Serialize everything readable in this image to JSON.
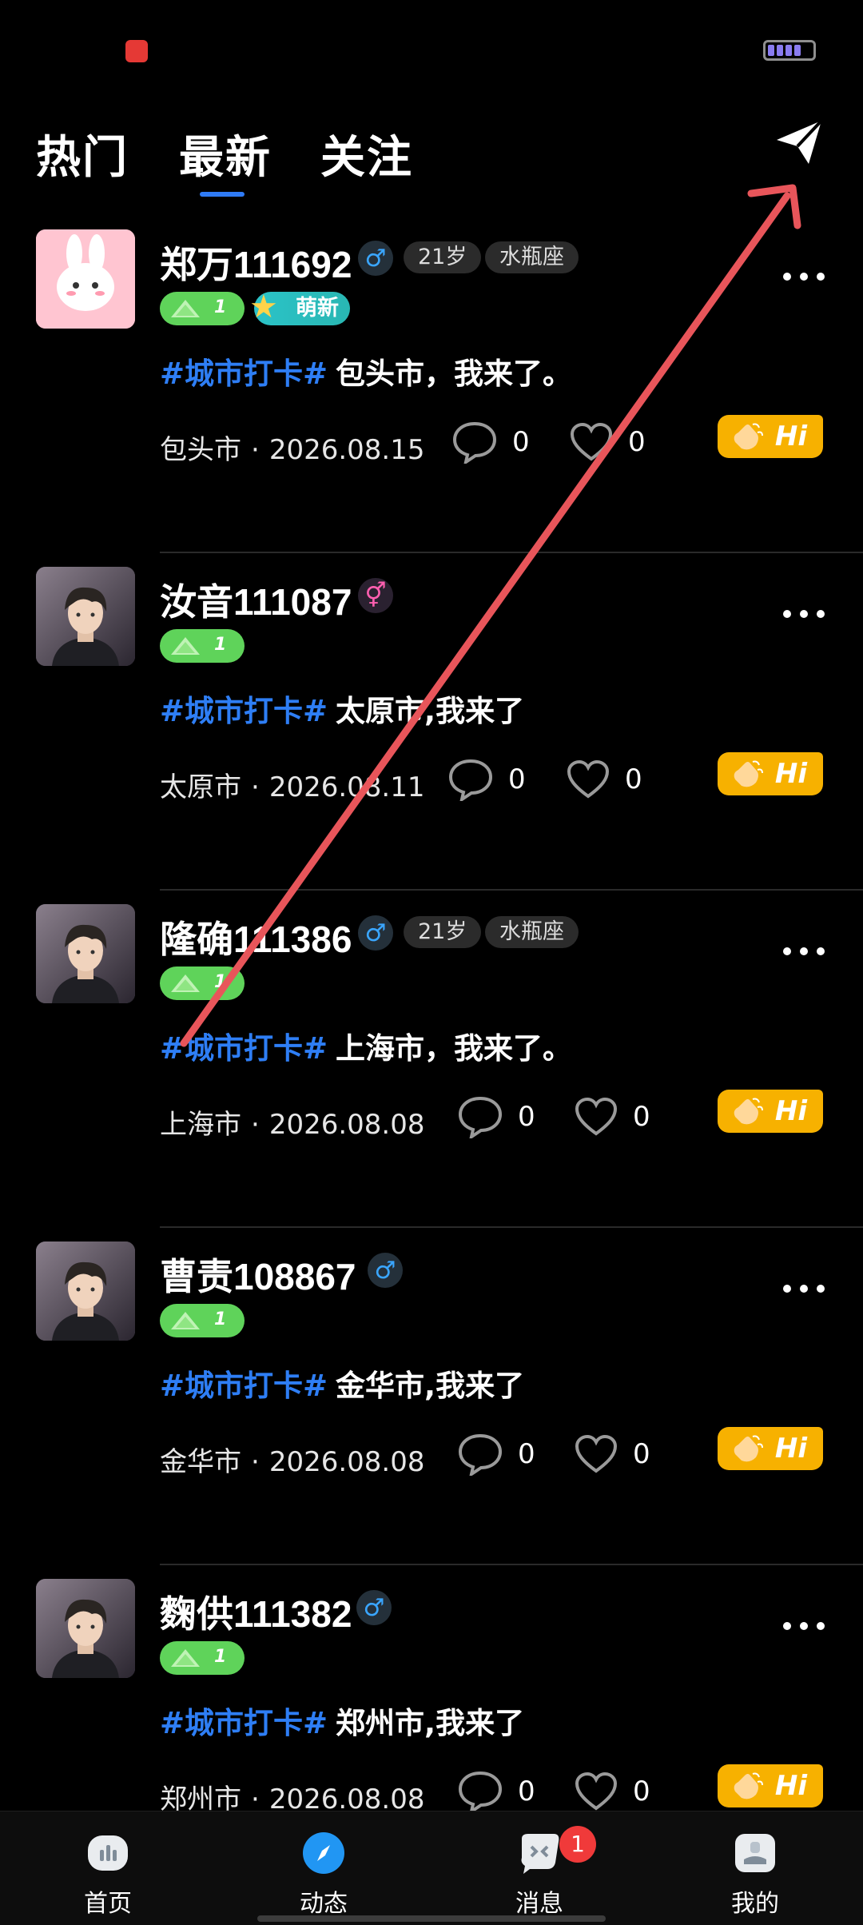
{
  "tabs": [
    {
      "label": "热门"
    },
    {
      "label": "最新"
    },
    {
      "label": "关注"
    }
  ],
  "active_tab": "最新",
  "posts": [
    {
      "name": "郑万111692",
      "gender": "male",
      "age": "21岁",
      "zodiac": "水瓶座",
      "level": "1",
      "newbie": "萌新",
      "hashtag": "#城市打卡#",
      "text": "包头市，我来了。",
      "city": "包头市",
      "date": "2026.08.15",
      "comments": "0",
      "likes": "0",
      "hi": "Hi"
    },
    {
      "name": "汝音111087",
      "gender": "female",
      "level": "1",
      "hashtag": "#城市打卡#",
      "text": "太原市,我来了",
      "city": "太原市",
      "date": "2026.08.11",
      "comments": "0",
      "likes": "0",
      "hi": "Hi"
    },
    {
      "name": "隆确111386",
      "gender": "male",
      "age": "21岁",
      "zodiac": "水瓶座",
      "level": "1",
      "hashtag": "#城市打卡#",
      "text": "上海市，我来了。",
      "city": "上海市",
      "date": "2026.08.08",
      "comments": "0",
      "likes": "0",
      "hi": "Hi"
    },
    {
      "name": "曹责108867",
      "gender": "male",
      "level": "1",
      "hashtag": "#城市打卡#",
      "text": "金华市,我来了",
      "city": "金华市",
      "date": "2026.08.08",
      "comments": "0",
      "likes": "0",
      "hi": "Hi"
    },
    {
      "name": "麴供111382",
      "gender": "male",
      "level": "1",
      "hashtag": "#城市打卡#",
      "text": "郑州市,我来了",
      "city": "郑州市",
      "date": "2026.08.08",
      "comments": "0",
      "likes": "0",
      "hi": "Hi"
    }
  ],
  "meta_separator": "·",
  "bottom_nav": [
    {
      "label": "首页",
      "icon": "home-icon"
    },
    {
      "label": "动态",
      "icon": "compass-icon"
    },
    {
      "label": "消息",
      "icon": "chat-icon",
      "badge": "1"
    },
    {
      "label": "我的",
      "icon": "profile-icon"
    }
  ],
  "colors": {
    "accent": "#2e7ef5",
    "hi_button": "#f7b100",
    "level_badge": "#5fd35a",
    "annotation_arrow": "#e8555a"
  }
}
